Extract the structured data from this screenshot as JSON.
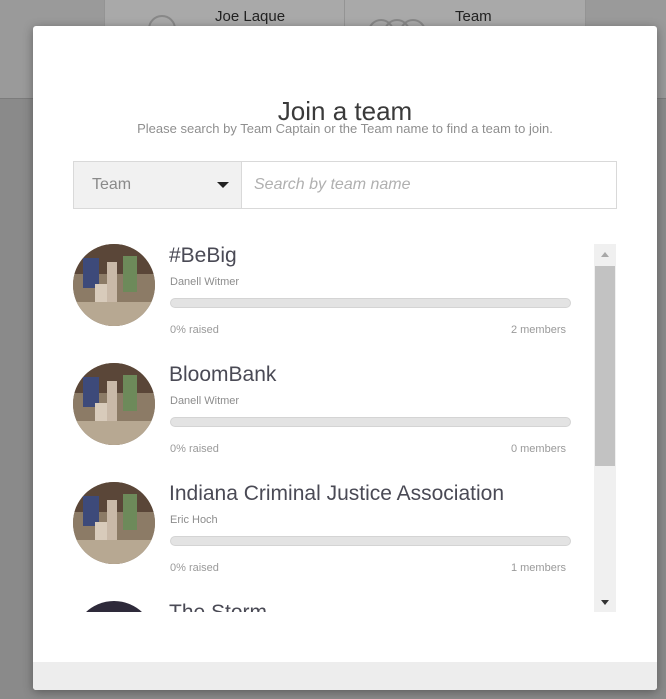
{
  "background": {
    "cells": [
      {
        "label": "Joe Laque"
      },
      {
        "label": "Team"
      }
    ]
  },
  "modal": {
    "title": "Join a team",
    "subtitle": "Please search by Team Captain or the Team name to find a team to join.",
    "search": {
      "type_selected": "Team",
      "placeholder": "Search by team name",
      "value": ""
    },
    "teams": [
      {
        "name": "#BeBig",
        "captain": "Danell Witmer",
        "raised": "0% raised",
        "raised_fraction": 0,
        "members": "2 members"
      },
      {
        "name": "BloomBank",
        "captain": "Danell Witmer",
        "raised": "0% raised",
        "raised_fraction": 0,
        "members": "0 members"
      },
      {
        "name": "Indiana Criminal Justice Association",
        "captain": "Eric Hoch",
        "raised": "0% raised",
        "raised_fraction": 0,
        "members": "1 members"
      },
      {
        "name": "The Storm",
        "captain": "",
        "raised": "",
        "raised_fraction": 0,
        "members": ""
      }
    ]
  },
  "colors": {
    "overlay": "#8a8a8a",
    "progress_track": "#e3e3e3",
    "title_text": "#3a3a3a"
  }
}
